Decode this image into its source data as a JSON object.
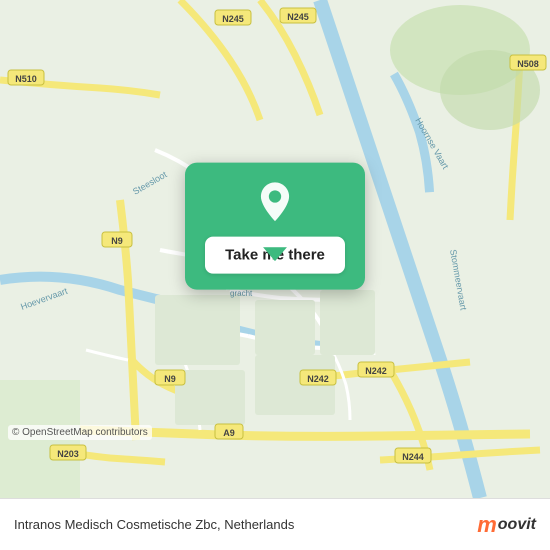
{
  "map": {
    "background_color": "#e8ede8",
    "copyright": "© OpenStreetMap contributors"
  },
  "popup": {
    "button_label": "Take me there",
    "pin_color": "#ffffff"
  },
  "bottom_bar": {
    "location_text": "Intranos Medisch Cosmetische Zbc, Netherlands",
    "logo_m": "m",
    "logo_text": "oovit"
  }
}
